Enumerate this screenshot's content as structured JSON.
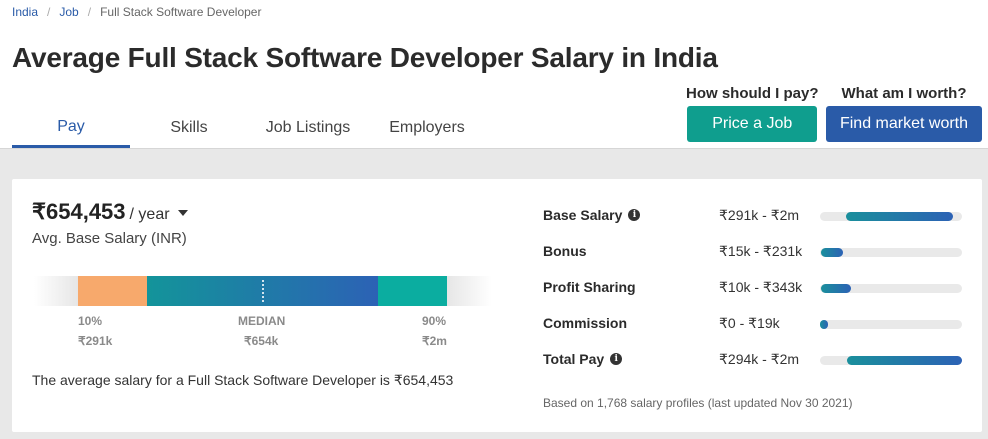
{
  "breadcrumb": {
    "items": [
      "India",
      "Job",
      "Full Stack Software Developer"
    ]
  },
  "page_title": "Average Full Stack Software Developer Salary in India",
  "tabs": [
    {
      "label": "Pay",
      "active": true
    },
    {
      "label": "Skills",
      "active": false
    },
    {
      "label": "Job Listings",
      "active": false
    },
    {
      "label": "Employers",
      "active": false
    }
  ],
  "cta": {
    "price_question": "How should I pay?",
    "price_button": "Price a Job",
    "worth_question": "What am I worth?",
    "worth_button": "Find market worth"
  },
  "salary": {
    "amount": "₹654,453",
    "period": "/ year",
    "subtitle": "Avg. Base Salary (INR)",
    "percentile_10_label": "10%",
    "median_label": "MEDIAN",
    "percentile_90_label": "90%",
    "percentile_10_value": "₹291k",
    "median_value": "₹654k",
    "percentile_90_value": "₹2m",
    "summary": "The average salary for a Full Stack Software Developer is ₹654,453"
  },
  "breakdown": {
    "rows": [
      {
        "label": "Base Salary",
        "info": true,
        "range": "₹291k - ₹2m",
        "bar_start": 0.18,
        "bar_end": 0.94
      },
      {
        "label": "Bonus",
        "info": false,
        "range": "₹15k - ₹231k",
        "bar_start": 0.01,
        "bar_end": 0.16
      },
      {
        "label": "Profit Sharing",
        "info": false,
        "range": "₹10k - ₹343k",
        "bar_start": 0.01,
        "bar_end": 0.22
      },
      {
        "label": "Commission",
        "info": false,
        "range": "₹0 - ₹19k",
        "bar_start": 0.0,
        "bar_end": 0.05
      },
      {
        "label": "Total Pay",
        "info": true,
        "range": "₹294k - ₹2m",
        "bar_start": 0.19,
        "bar_end": 1.0
      }
    ],
    "footnote": "Based on 1,768 salary profiles (last updated Nov 30 2021)"
  },
  "colors": {
    "brand_blue": "#2a5ba8",
    "teal": "#0f9e8e",
    "orange": "#f7a96c"
  }
}
